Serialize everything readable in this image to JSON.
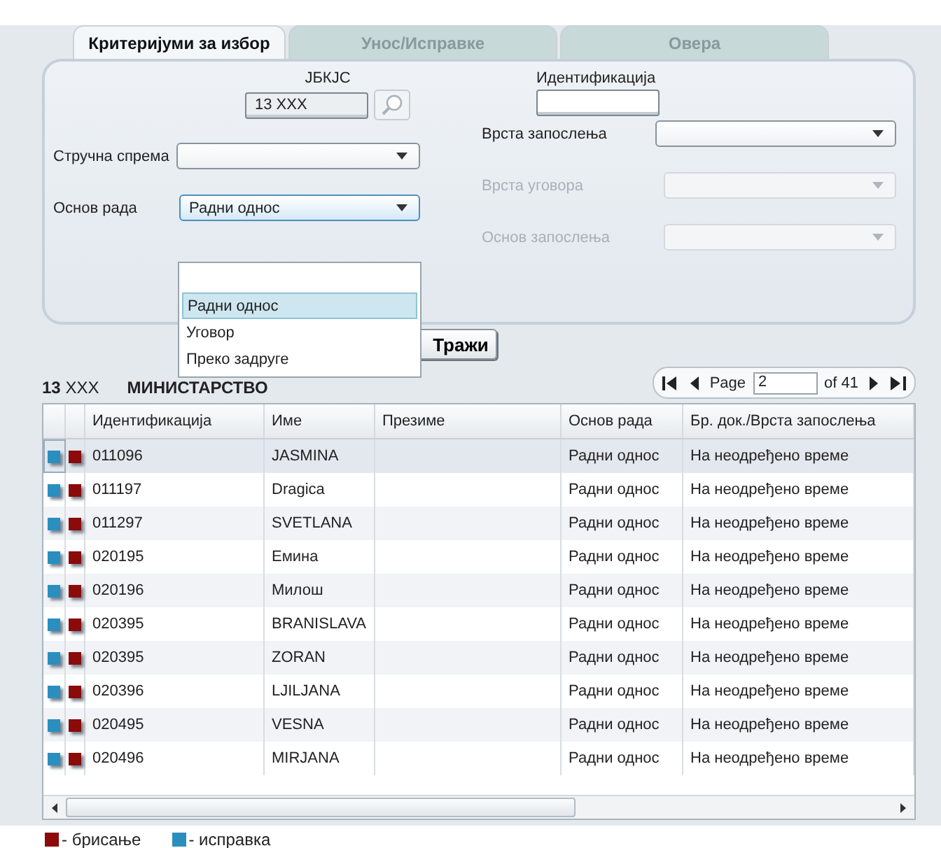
{
  "tabs": [
    {
      "label": "Критеријуми за избор",
      "selected": true
    },
    {
      "label": "Унос/Исправке",
      "selected": false
    },
    {
      "label": "Овера",
      "selected": false
    }
  ],
  "form": {
    "jbkjc": {
      "label": "ЈБКЈС",
      "value": "13 XXX"
    },
    "identification": {
      "label": "Идентификација"
    },
    "left": [
      {
        "label": "Стручна спрема",
        "disabled": false,
        "focused": false
      },
      {
        "label": "Основ рада",
        "value": "Радни однос",
        "disabled": false,
        "focused": true
      }
    ],
    "right": [
      {
        "label": "Врста запослења",
        "disabled": false,
        "focused": false
      },
      {
        "label": "Врста уговора",
        "disabled": true,
        "focused": false
      },
      {
        "label": "Основ запослења",
        "disabled": true,
        "focused": false
      }
    ],
    "dropdown": [
      {
        "selected": false
      },
      {
        "label": "Радни однос",
        "selected": true
      },
      {
        "label": "Уговор",
        "selected": false
      },
      {
        "label": "Преко задруге",
        "selected": false
      }
    ]
  },
  "search_button": "Тражи",
  "info": {
    "code": "13",
    "code_rest": "XXX",
    "ministry": "МИНИСТАРСТВО"
  },
  "pager": {
    "page_label": "Page",
    "page": "2",
    "of": "of 41"
  },
  "table": {
    "columns": [
      "Идентификација",
      "Име",
      "Презиме",
      "Основ рада",
      "Бр. док./Врста запослења"
    ],
    "rows": [
      {
        "id": "011096",
        "name": "JASMINA",
        "basis": "Радни однос",
        "type": "На неодређено време",
        "selected": true
      },
      {
        "id": "011197",
        "name": "Dragica",
        "basis": "Радни однос",
        "type": "На неодређено време",
        "selected": false
      },
      {
        "id": "011297",
        "name": "SVETLANA",
        "basis": "Радни однос",
        "type": "На неодређено време",
        "selected": false
      },
      {
        "id": "020195",
        "name": "Емина",
        "basis": "Радни однос",
        "type": "На неодређено време",
        "selected": false
      },
      {
        "id": "020196",
        "name": "Милош",
        "basis": "Радни однос",
        "type": "На неодређено време",
        "selected": false
      },
      {
        "id": "020395",
        "name": "BRANISLAVA",
        "basis": "Радни однос",
        "type": "На неодређено време",
        "selected": false
      },
      {
        "id": "020395",
        "name": "ZORAN",
        "basis": "Радни однос",
        "type": "На неодређено време",
        "selected": false
      },
      {
        "id": "020396",
        "name": "LJILJANA",
        "basis": "Радни однос",
        "type": "На неодређено време",
        "selected": false
      },
      {
        "id": "020495",
        "name": "VESNA",
        "basis": "Радни однос",
        "type": "На неодређено време",
        "selected": false
      },
      {
        "id": "020496",
        "name": "MIRJANA",
        "basis": "Радни однос",
        "type": "На неодређено време",
        "selected": false
      }
    ]
  },
  "legend": [
    {
      "kind": "delete",
      "label": "- брисање"
    },
    {
      "kind": "edit",
      "label": "- исправка"
    }
  ]
}
